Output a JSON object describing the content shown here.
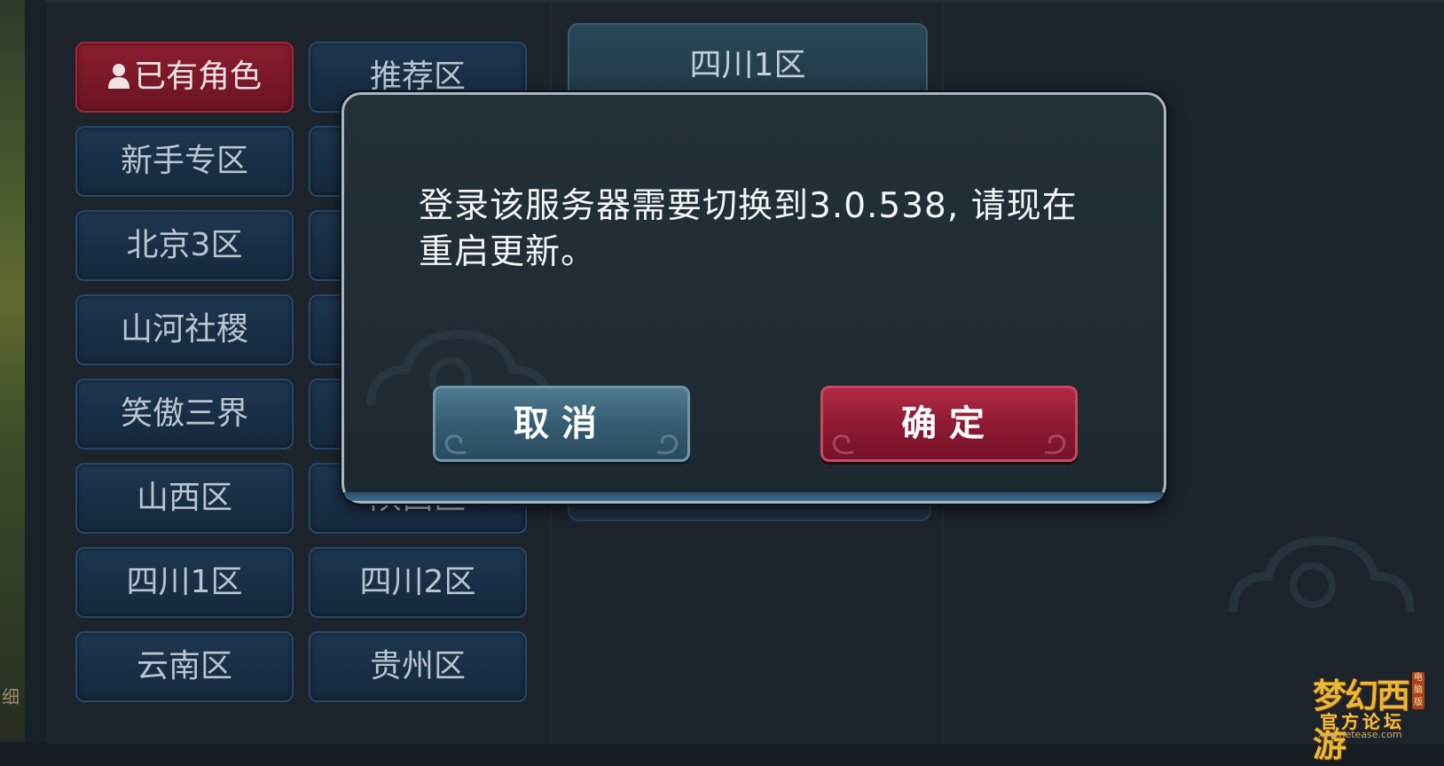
{
  "server_list": {
    "left_column": [
      {
        "label": "已有角色",
        "icon": "person-icon",
        "active": true
      },
      {
        "label": "新手专区"
      },
      {
        "label": "北京3区"
      },
      {
        "label": "山河社稷"
      },
      {
        "label": "笑傲三界"
      },
      {
        "label": "山西区"
      },
      {
        "label": "四川1区"
      },
      {
        "label": "云南区"
      }
    ],
    "right_column": [
      {
        "label": "推荐区"
      },
      {
        "label": ""
      },
      {
        "label": ""
      },
      {
        "label": ""
      },
      {
        "label": ""
      },
      {
        "label": "陕西区"
      },
      {
        "label": "四川2区"
      },
      {
        "label": "贵州区"
      }
    ]
  },
  "selected_server": {
    "label": "四川1区"
  },
  "dialog": {
    "message": "登录该服务器需要切换到3.0.538, 请现在重启更新。",
    "cancel_label": "取消",
    "confirm_label": "确定"
  },
  "edge_text": "细",
  "watermark": {
    "logo": "梦幻西游",
    "subtitle": "官方论坛",
    "url": "xyq.netease.com",
    "tag": "电脑版"
  },
  "colors": {
    "active_server": "#8a1e2f",
    "server_button": "#1d3650",
    "confirm_button": "#8c1831",
    "cancel_button": "#335a70",
    "dialog_bg": "#243038"
  }
}
